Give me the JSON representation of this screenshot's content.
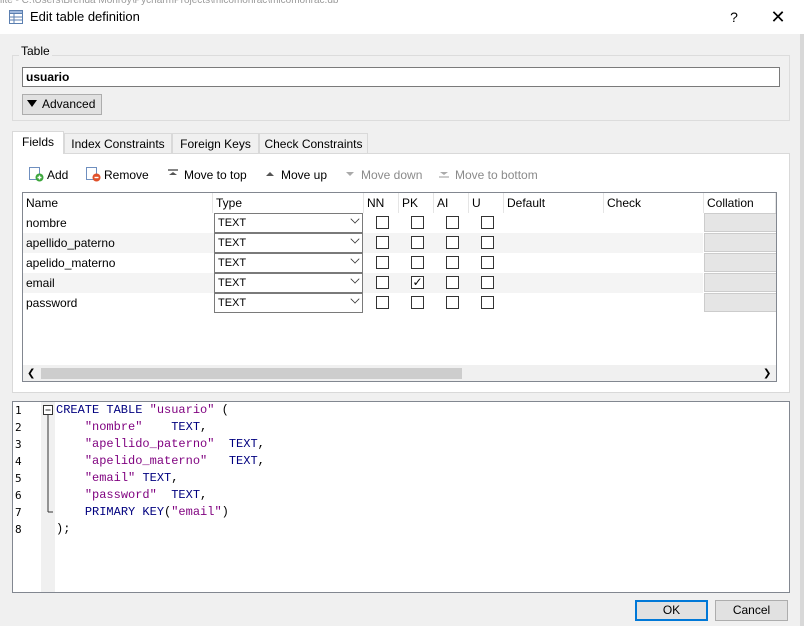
{
  "window": {
    "title": "Edit table definition",
    "help_label": "?",
    "close_label": "✕",
    "background_text": "lite - C:\\Users\\Brenda Monroy\\PycharmProjects\\micomonrac\\micomonrac.db"
  },
  "table_group": {
    "label": "Table",
    "name_value": "usuario",
    "advanced_label": "Advanced"
  },
  "tabs": [
    {
      "label": "Fields",
      "active": true
    },
    {
      "label": "Index Constraints",
      "active": false
    },
    {
      "label": "Foreign Keys",
      "active": false
    },
    {
      "label": "Check Constraints",
      "active": false
    }
  ],
  "toolbar": {
    "add": "Add",
    "remove": "Remove",
    "move_top": "Move to top",
    "move_up": "Move up",
    "move_down": "Move down",
    "move_bottom": "Move to bottom"
  },
  "grid": {
    "columns": [
      "Name",
      "Type",
      "NN",
      "PK",
      "AI",
      "U",
      "Default",
      "Check",
      "Collation"
    ],
    "rows": [
      {
        "name": "nombre",
        "type": "TEXT",
        "nn": false,
        "pk": false,
        "ai": false,
        "u": false
      },
      {
        "name": "apellido_paterno",
        "type": "TEXT",
        "nn": false,
        "pk": false,
        "ai": false,
        "u": false
      },
      {
        "name": "apelido_materno",
        "type": "TEXT",
        "nn": false,
        "pk": false,
        "ai": false,
        "u": false
      },
      {
        "name": "email",
        "type": "TEXT",
        "nn": false,
        "pk": true,
        "ai": false,
        "u": false
      },
      {
        "name": "password",
        "type": "TEXT",
        "nn": false,
        "pk": false,
        "ai": false,
        "u": false
      }
    ]
  },
  "sql": {
    "line_numbers": [
      "1",
      "2",
      "3",
      "4",
      "5",
      "6",
      "7",
      "8"
    ],
    "lines": [
      [
        {
          "t": "CREATE TABLE ",
          "c": "kw"
        },
        {
          "t": "\"usuario\"",
          "c": "str"
        },
        {
          "t": " (",
          "c": "pun"
        }
      ],
      [
        {
          "t": "    ",
          "c": "pun"
        },
        {
          "t": "\"nombre\"",
          "c": "str"
        },
        {
          "t": "    ",
          "c": "pun"
        },
        {
          "t": "TEXT",
          "c": "kw"
        },
        {
          "t": ",",
          "c": "pun"
        }
      ],
      [
        {
          "t": "    ",
          "c": "pun"
        },
        {
          "t": "\"apellido_paterno\"",
          "c": "str"
        },
        {
          "t": "  ",
          "c": "pun"
        },
        {
          "t": "TEXT",
          "c": "kw"
        },
        {
          "t": ",",
          "c": "pun"
        }
      ],
      [
        {
          "t": "    ",
          "c": "pun"
        },
        {
          "t": "\"apelido_materno\"",
          "c": "str"
        },
        {
          "t": "   ",
          "c": "pun"
        },
        {
          "t": "TEXT",
          "c": "kw"
        },
        {
          "t": ",",
          "c": "pun"
        }
      ],
      [
        {
          "t": "    ",
          "c": "pun"
        },
        {
          "t": "\"email\"",
          "c": "str"
        },
        {
          "t": " ",
          "c": "pun"
        },
        {
          "t": "TEXT",
          "c": "kw"
        },
        {
          "t": ",",
          "c": "pun"
        }
      ],
      [
        {
          "t": "    ",
          "c": "pun"
        },
        {
          "t": "\"password\"",
          "c": "str"
        },
        {
          "t": "  ",
          "c": "pun"
        },
        {
          "t": "TEXT",
          "c": "kw"
        },
        {
          "t": ",",
          "c": "pun"
        }
      ],
      [
        {
          "t": "    ",
          "c": "pun"
        },
        {
          "t": "PRIMARY KEY",
          "c": "kw"
        },
        {
          "t": "(",
          "c": "pun"
        },
        {
          "t": "\"email\"",
          "c": "str"
        },
        {
          "t": ")",
          "c": "pun"
        }
      ],
      [
        {
          "t": ");",
          "c": "pun"
        }
      ]
    ]
  },
  "buttons": {
    "ok": "OK",
    "cancel": "Cancel"
  },
  "colors": {
    "keyword": "#00007f",
    "string": "#7f007f",
    "accent": "#0078d7"
  }
}
